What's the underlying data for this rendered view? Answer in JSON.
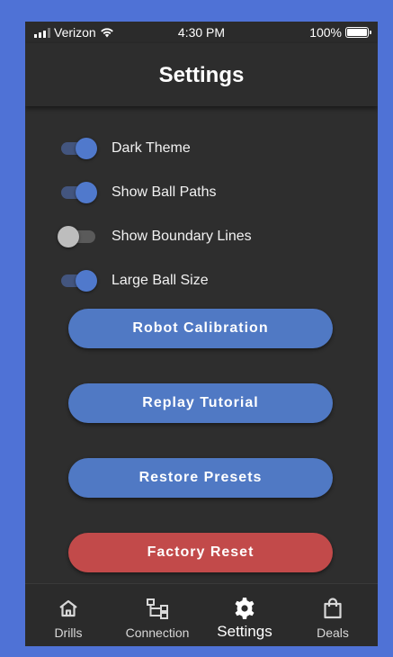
{
  "status_bar": {
    "carrier": "Verizon",
    "time": "4:30 PM",
    "battery": "100%"
  },
  "header": {
    "title": "Settings"
  },
  "toggles": [
    {
      "label": "Dark Theme",
      "on": true
    },
    {
      "label": "Show Ball Paths",
      "on": true
    },
    {
      "label": "Show Boundary Lines",
      "on": false
    },
    {
      "label": "Large Ball Size",
      "on": true
    }
  ],
  "buttons": {
    "robot_calibration": "Robot Calibration",
    "replay_tutorial": "Replay Tutorial",
    "restore_presets": "Restore Presets",
    "factory_reset": "Factory Reset"
  },
  "nav": {
    "items": [
      {
        "label": "Drills",
        "icon": "home-icon"
      },
      {
        "label": "Connection",
        "icon": "network-icon"
      },
      {
        "label": "Settings",
        "icon": "gear-icon",
        "active": true
      },
      {
        "label": "Deals",
        "icon": "shopping-bag-icon"
      }
    ]
  },
  "colors": {
    "frame": "#4f72d6",
    "background": "#2e2e2e",
    "accent": "#5079c4",
    "danger": "#c24a4a"
  }
}
